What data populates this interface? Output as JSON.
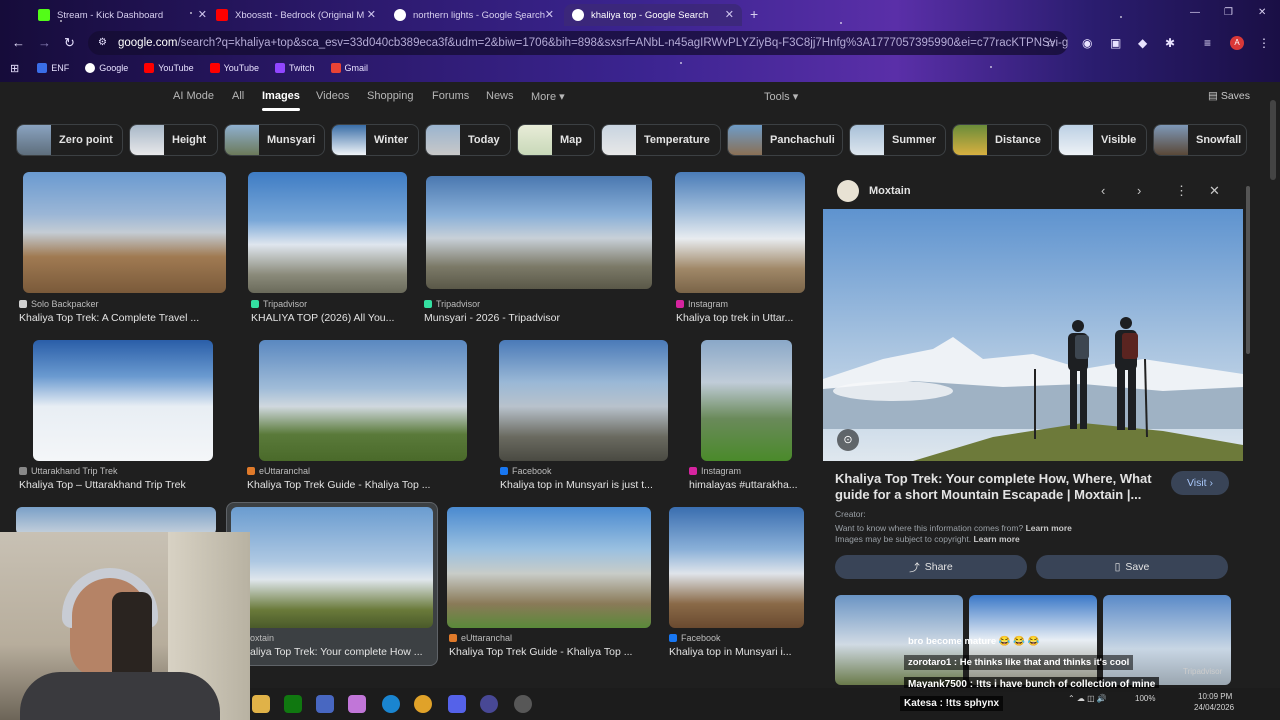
{
  "browser": {
    "tabs": [
      {
        "label": "Stream - Kick Dashboard",
        "color": "#53fc18"
      },
      {
        "label": "Xboosstt - Bedrock (Original M",
        "color": "#ff0000"
      },
      {
        "label": "northern lights - Google Search",
        "color": "#ffffff"
      },
      {
        "label": "khaliya top - Google Search",
        "color": "#ffffff"
      }
    ],
    "new_tab": "+",
    "url_host": "google.com",
    "url_rest": "/search?q=khaliya+top&sca_esv=33d040cb389eca3f&udm=2&biw=1706&bih=898&sxsrf=ANbL-n45agIRWvPLYZiyBq-F3C8jj7Hnfg%3A1777057395990&ei=c77racKTPNSvi-gPh-qbqAI...",
    "bookmarks": [
      {
        "label": "ENF",
        "color": "#3a6ee8"
      },
      {
        "label": "Google",
        "color": "#ffffff"
      },
      {
        "label": "YouTube",
        "color": "#ff0000"
      },
      {
        "label": "YouTube",
        "color": "#ff0000"
      },
      {
        "label": "Twitch",
        "color": "#9146ff"
      },
      {
        "label": "Gmail",
        "color": "#ea4335"
      }
    ],
    "profile_initial": "A"
  },
  "google": {
    "tabs": [
      "AI Mode",
      "All",
      "Images",
      "Videos",
      "Shopping",
      "Forums",
      "News",
      "More"
    ],
    "active_tab": "Images",
    "tools": "Tools",
    "saves": "Saves",
    "chips": [
      "Zero point",
      "Height",
      "Munsyari",
      "Winter",
      "Today",
      "Map",
      "Temperature",
      "Panchachuli",
      "Summer",
      "Distance",
      "Visible",
      "Snowfall"
    ]
  },
  "results": [
    {
      "source": "Solo Backpacker",
      "title": "Khaliya Top Trek: A Complete Travel ..."
    },
    {
      "source": "Tripadvisor",
      "title": "KHALIYA TOP (2026) All You..."
    },
    {
      "source": "Tripadvisor",
      "title": "Munsyari - 2026 - Tripadvisor"
    },
    {
      "source": "Instagram",
      "title": "Khaliya top trek in Uttar..."
    },
    {
      "source": "Uttarakhand Trip Trek",
      "title": "Khaliya Top – Uttarakhand Trip Trek"
    },
    {
      "source": "eUttaranchal",
      "title": "Khaliya Top Trek Guide - Khaliya Top ..."
    },
    {
      "source": "Facebook",
      "title": "Khaliya top in Munsyari is just t..."
    },
    {
      "source": "Instagram",
      "title": "himalayas #uttarakha..."
    },
    {
      "source": "oxtain",
      "title": "aliya Top Trek: Your complete How ..."
    },
    {
      "source": "eUttaranchal",
      "title": "Khaliya Top Trek Guide - Khaliya Top ..."
    },
    {
      "source": "Facebook",
      "title": "Khaliya top in Munsyari i..."
    }
  ],
  "panel": {
    "site": "Moxtain",
    "title": "Khaliya Top Trek: Your complete How, Where, What guide for a short Mountain Escapade | Moxtain |...",
    "visit": "Visit",
    "creator": "Creator:",
    "info_q": "Want to know where this information comes from?",
    "learn_more": "Learn more",
    "copyright": "Images may be subject to copyright.",
    "share": "Share",
    "save": "Save"
  },
  "chat": [
    "bro become mature 😂 😂 😂",
    "zorotaro1 : He thinks like that and thinks it's cool",
    "Mayank7500 : !tts i have bunch of collection of mine",
    "Katesa : !tts sphynx"
  ],
  "partial_source": "Tripadvisor",
  "taskbar": {
    "battery": "100%",
    "time": "10:09 PM",
    "date": "24/04/2026"
  }
}
